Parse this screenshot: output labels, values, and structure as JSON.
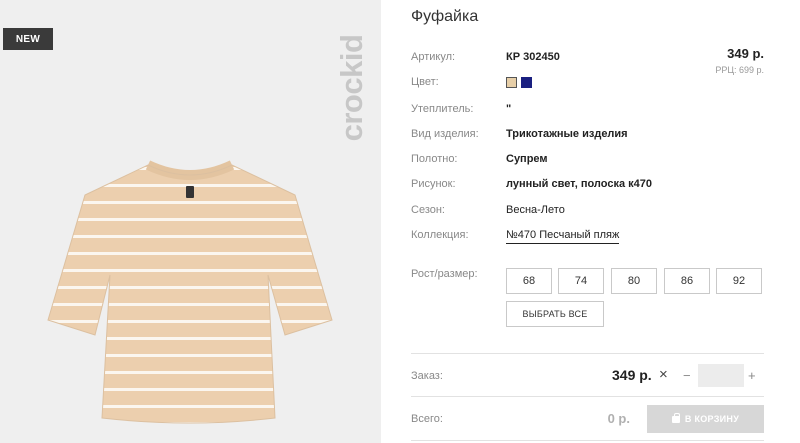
{
  "badge": {
    "new": "NEW"
  },
  "brand": {
    "watermark": "crockid"
  },
  "product": {
    "title": "Фуфайка",
    "price": "349 р.",
    "rrp": "РРЦ: 699 р.",
    "colors": [
      "#e7cfa8",
      "#1a1f80"
    ],
    "details": [
      {
        "label": "Артикул:",
        "value": "КР 302450"
      },
      {
        "label": "Цвет:",
        "value": ""
      },
      {
        "label": "Утеплитель:",
        "value": "\""
      },
      {
        "label": "Вид изделия:",
        "value": "Трикотажные изделия"
      },
      {
        "label": "Полотно:",
        "value": "Супрем"
      },
      {
        "label": "Рисунок:",
        "value": "лунный свет, полоска к470"
      },
      {
        "label": "Сезон:",
        "value": "Весна-Лето"
      },
      {
        "label": "Коллекция:",
        "value": "№470 Песчаный пляж"
      }
    ],
    "size_label": "Рост/размер:",
    "sizes": [
      "68",
      "74",
      "80",
      "86",
      "92"
    ],
    "select_all": "ВЫБРАТЬ ВСЕ"
  },
  "order": {
    "label": "Заказ:",
    "price": "349 р.",
    "times": "×",
    "minus": "−",
    "plus": "+",
    "quantity": ""
  },
  "total": {
    "label": "Всего:",
    "value": "0 р.",
    "cart_button": "В КОРЗИНУ"
  }
}
